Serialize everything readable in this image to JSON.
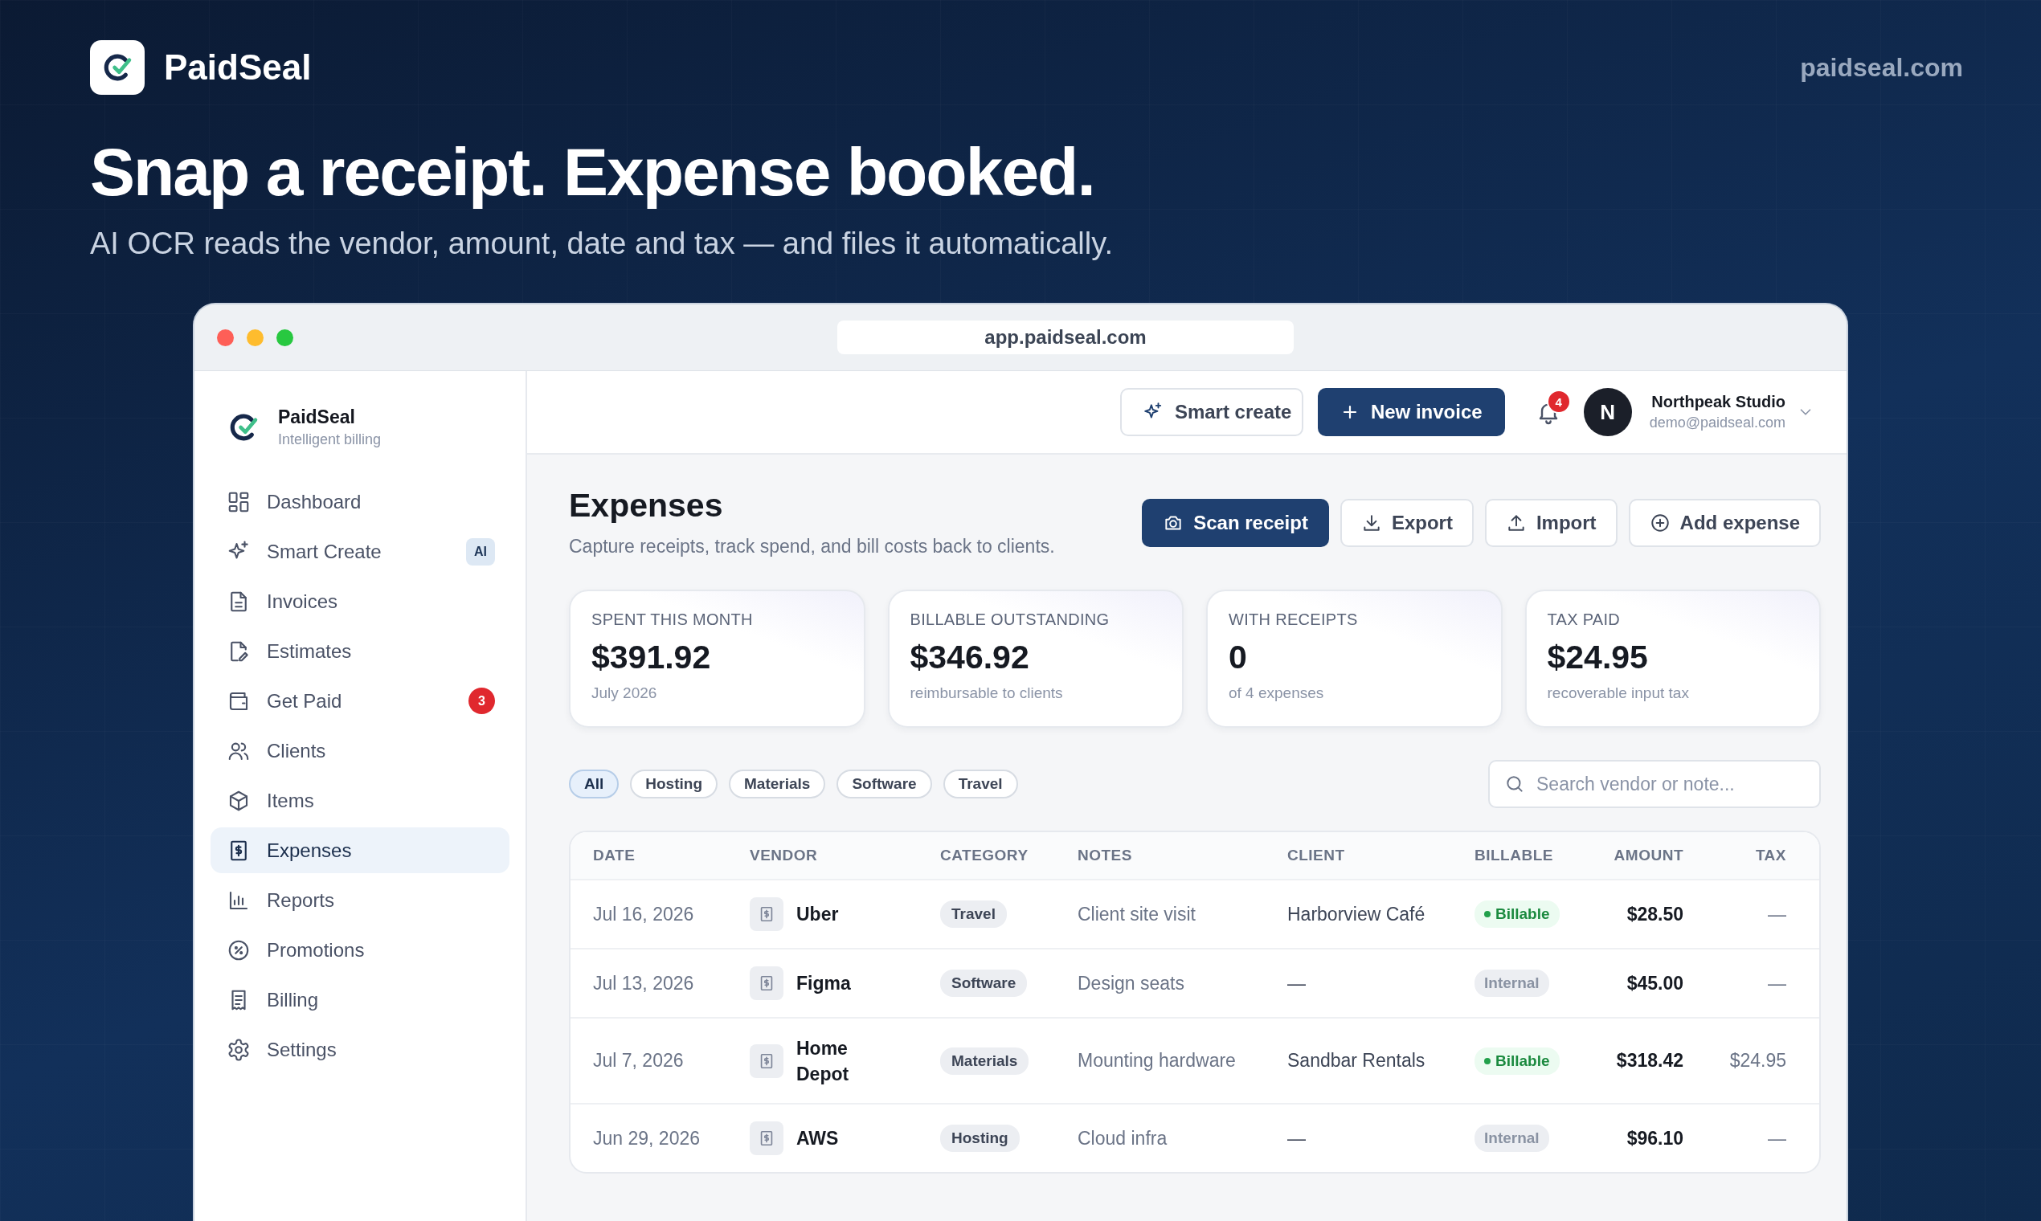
{
  "brand": {
    "name": "PaidSeal",
    "site": "paidseal.com"
  },
  "hero": {
    "headline": "Snap a receipt. Expense booked.",
    "subtitle": "AI OCR reads the vendor, amount, date and tax — and files it automatically."
  },
  "browser": {
    "url": "app.paidseal.com"
  },
  "sidebar": {
    "brand": "PaidSeal",
    "tagline": "Intelligent billing",
    "items": [
      {
        "label": "Dashboard",
        "selected": false
      },
      {
        "label": "Smart Create",
        "selected": false,
        "badge": {
          "kind": "tag",
          "text": "AI"
        }
      },
      {
        "label": "Invoices",
        "selected": false
      },
      {
        "label": "Estimates",
        "selected": false
      },
      {
        "label": "Get Paid",
        "selected": false,
        "badge": {
          "kind": "count",
          "text": "3"
        }
      },
      {
        "label": "Clients",
        "selected": false
      },
      {
        "label": "Items",
        "selected": false
      },
      {
        "label": "Expenses",
        "selected": true
      },
      {
        "label": "Reports",
        "selected": false
      },
      {
        "label": "Promotions",
        "selected": false
      },
      {
        "label": "Billing",
        "selected": false
      },
      {
        "label": "Settings",
        "selected": false
      }
    ]
  },
  "topbar": {
    "smart_create": "Smart create",
    "new_invoice": "New invoice",
    "notifications": "4",
    "account": {
      "initial": "N",
      "name": "Northpeak Studio",
      "email": "demo@paidseal.com"
    }
  },
  "page": {
    "title": "Expenses",
    "subtitle": "Capture receipts, track spend, and bill costs back to clients.",
    "actions": [
      {
        "label": "Scan receipt",
        "primary": true
      },
      {
        "label": "Export",
        "primary": false
      },
      {
        "label": "Import",
        "primary": false
      },
      {
        "label": "Add expense",
        "primary": false
      }
    ]
  },
  "stats": [
    {
      "label": "SPENT THIS MONTH",
      "value": "$391.92",
      "note": "July 2026"
    },
    {
      "label": "BILLABLE OUTSTANDING",
      "value": "$346.92",
      "note": "reimbursable to clients"
    },
    {
      "label": "WITH RECEIPTS",
      "value": "0",
      "note": "of 4 expenses"
    },
    {
      "label": "TAX PAID",
      "value": "$24.95",
      "note": "recoverable input tax"
    }
  ],
  "filters": [
    {
      "label": "All",
      "selected": true
    },
    {
      "label": "Hosting",
      "selected": false
    },
    {
      "label": "Materials",
      "selected": false
    },
    {
      "label": "Software",
      "selected": false
    },
    {
      "label": "Travel",
      "selected": false
    }
  ],
  "search": {
    "placeholder": "Search vendor or note..."
  },
  "table": {
    "columns": [
      "DATE",
      "VENDOR",
      "CATEGORY",
      "NOTES",
      "CLIENT",
      "BILLABLE",
      "AMOUNT",
      "TAX"
    ],
    "rows": [
      {
        "date": "Jul 16, 2026",
        "vendor": "Uber",
        "category": "Travel",
        "notes": "Client site visit",
        "client": "Harborview Café",
        "billable": {
          "label": "Billable",
          "on": true
        },
        "amount": "$28.50",
        "tax": "—"
      },
      {
        "date": "Jul 13, 2026",
        "vendor": "Figma",
        "category": "Software",
        "notes": "Design seats",
        "client": "—",
        "billable": {
          "label": "Internal",
          "on": false
        },
        "amount": "$45.00",
        "tax": "—"
      },
      {
        "date": "Jul 7, 2026",
        "vendor": "Home Depot",
        "category": "Materials",
        "notes": "Mounting hardware",
        "client": "Sandbar Rentals",
        "billable": {
          "label": "Billable",
          "on": true
        },
        "amount": "$318.42",
        "tax": "$24.95"
      },
      {
        "date": "Jun 29, 2026",
        "vendor": "AWS",
        "category": "Hosting",
        "notes": "Cloud infra",
        "client": "—",
        "billable": {
          "label": "Internal",
          "on": false
        },
        "amount": "$96.10",
        "tax": "—"
      }
    ]
  }
}
